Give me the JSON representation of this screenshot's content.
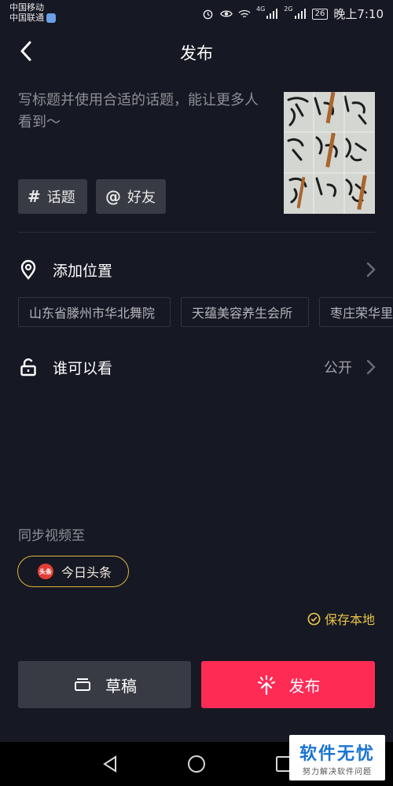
{
  "status_bar": {
    "carrier_1": "中国移动",
    "carrier_2": "中国联通",
    "signal_1": "4G",
    "signal_2": "2G",
    "battery": "26",
    "time": "晚上7:10"
  },
  "header": {
    "title": "发布"
  },
  "caption": {
    "placeholder": "写标题并使用合适的话题，能让更多人看到～"
  },
  "chips": {
    "topic": {
      "icon": "#",
      "label": "话题"
    },
    "friend": {
      "icon": "@",
      "label": "好友"
    }
  },
  "location": {
    "label": "添加位置",
    "suggestions": [
      "山东省滕州市华北舞院",
      "天蕴美容养生会所",
      "枣庄荣华里"
    ]
  },
  "visibility": {
    "label": "谁可以看",
    "value": "公开"
  },
  "sync": {
    "title": "同步视频至",
    "toutiao_logo_text": "头条",
    "toutiao_label": "今日头条"
  },
  "save_local": {
    "label": "保存本地"
  },
  "actions": {
    "draft_label": "草稿",
    "publish_label": "发布"
  },
  "watermark": {
    "title": "软件无忧",
    "subtitle": "努力解决软件问题"
  },
  "colors": {
    "background": "#161823",
    "accent": "#fe2c55",
    "gold": "#e2b538"
  }
}
